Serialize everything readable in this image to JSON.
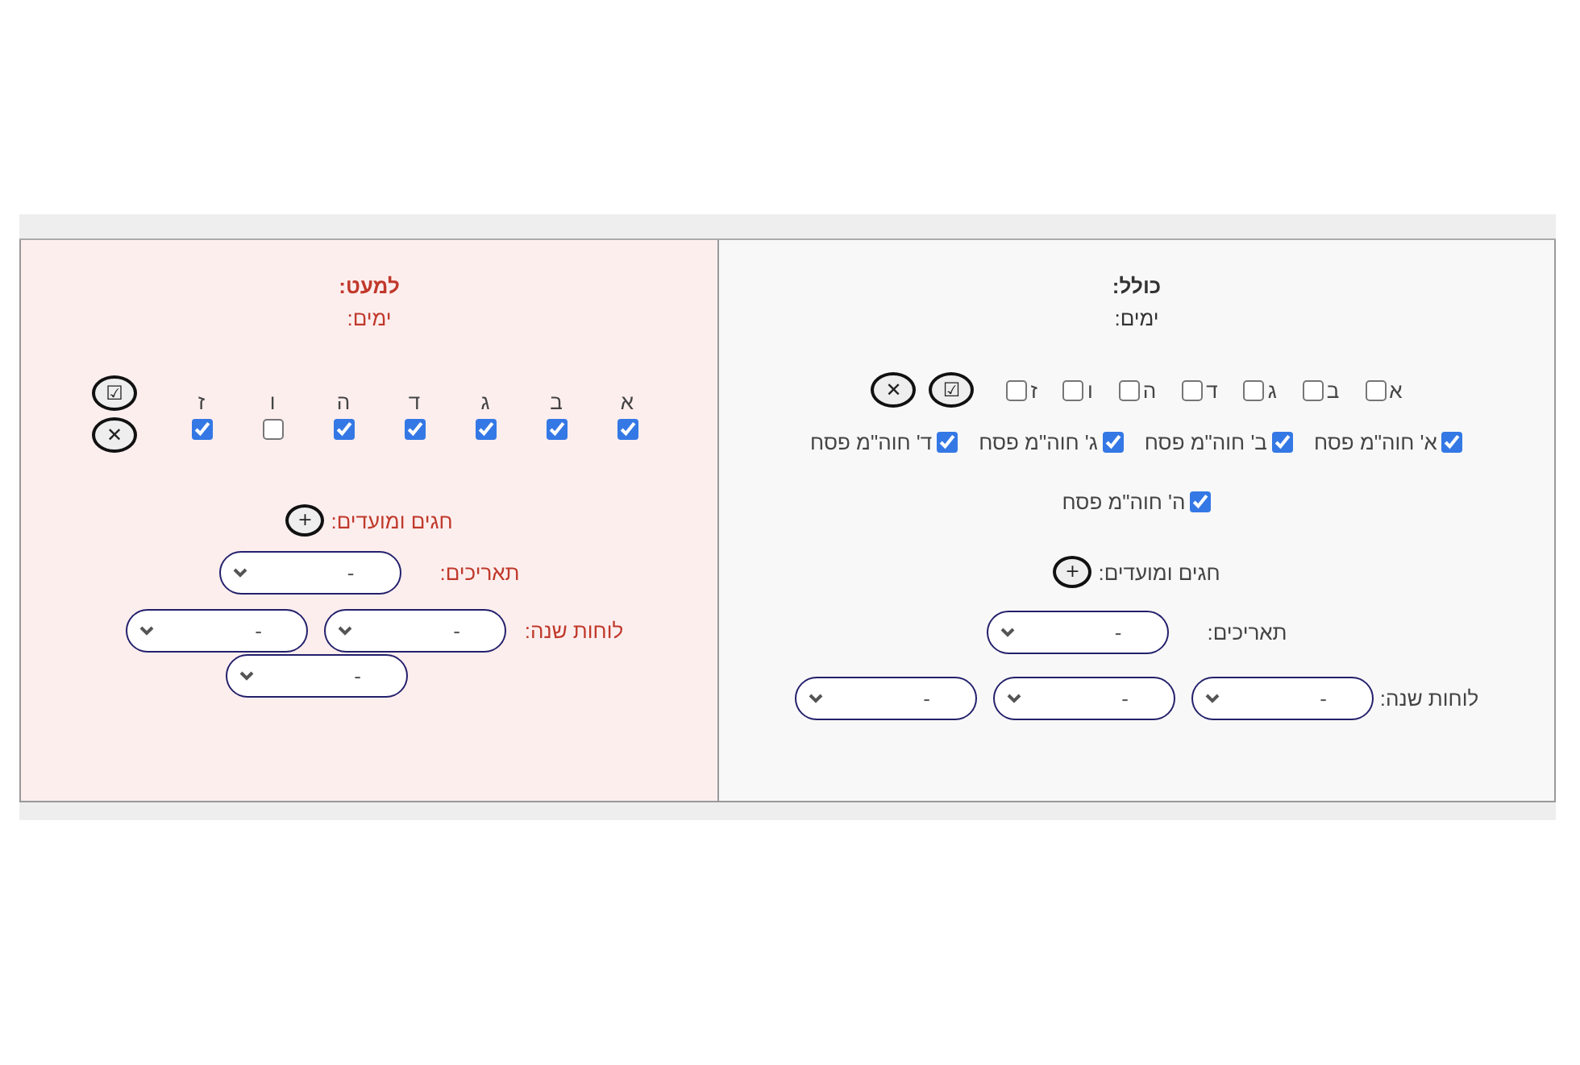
{
  "panels": [
    {
      "kind": "include",
      "title": "כולל:",
      "days_label": "ימים:",
      "days": [
        {
          "label": "א",
          "checked": false
        },
        {
          "label": "ב",
          "checked": false
        },
        {
          "label": "ג",
          "checked": false
        },
        {
          "label": "ד",
          "checked": false
        },
        {
          "label": "ה",
          "checked": false
        },
        {
          "label": "ו",
          "checked": false
        },
        {
          "label": "ז",
          "checked": false
        }
      ],
      "select_all_button": "☑",
      "clear_button": "✕",
      "holidays": [
        {
          "label": "א' חוה\"מ פסח",
          "checked": true
        },
        {
          "label": "ב' חוה\"מ פסח",
          "checked": true
        },
        {
          "label": "ג' חוה\"מ פסח",
          "checked": true
        },
        {
          "label": "ד' חוה\"מ פסח",
          "checked": true
        },
        {
          "label": "ה' חוה\"מ פסח",
          "checked": true
        }
      ],
      "holidays_label": "חגים ומועדים:",
      "add_button": "+",
      "dates_label": "תאריכים:",
      "dates_selects": [
        {
          "value": "-"
        }
      ],
      "calendar_label": "לוחות שנה:",
      "calendar_selects": [
        {
          "value": "-"
        },
        {
          "value": "-"
        },
        {
          "value": "-"
        }
      ]
    },
    {
      "kind": "exclude",
      "title": "למעט:",
      "days_label": "ימים:",
      "days": [
        {
          "label": "א",
          "checked": true
        },
        {
          "label": "ב",
          "checked": true
        },
        {
          "label": "ג",
          "checked": true
        },
        {
          "label": "ד",
          "checked": true
        },
        {
          "label": "ה",
          "checked": true
        },
        {
          "label": "ו",
          "checked": false
        },
        {
          "label": "ז",
          "checked": true
        }
      ],
      "select_all_button": "☑",
      "clear_button": "✕",
      "holidays_label": "חגים ומועדים:",
      "add_button": "+",
      "dates_label": "תאריכים:",
      "dates_selects": [
        {
          "value": "-"
        }
      ],
      "calendar_label": "לוחות שנה:",
      "calendar_selects": [
        {
          "value": "-"
        },
        {
          "value": "-"
        },
        {
          "value": "-"
        }
      ]
    }
  ]
}
